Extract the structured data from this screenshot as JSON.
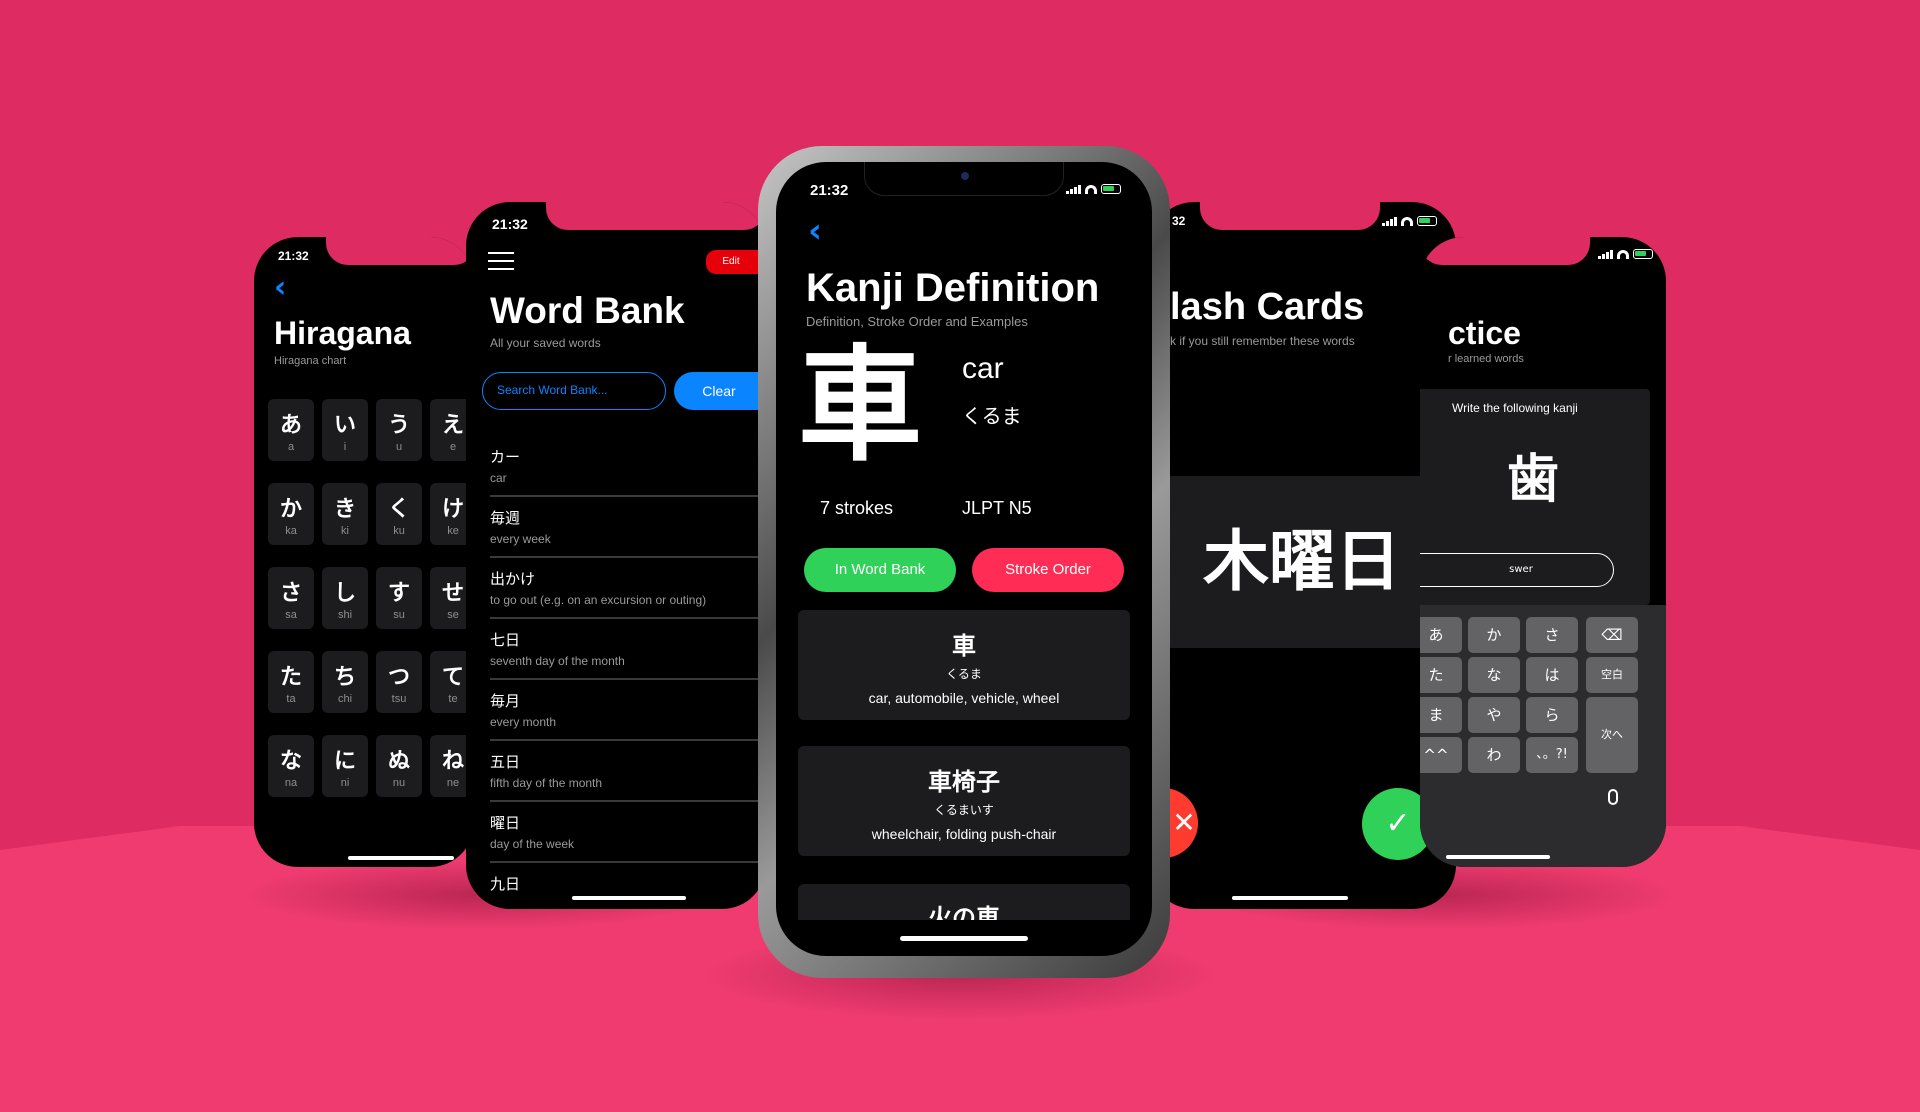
{
  "colors": {
    "background": "#de2c63",
    "accent_blue": "#0a84ff",
    "green": "#30d158",
    "red": "#ff2d55",
    "card": "#1c1c1e"
  },
  "hiragana_screen": {
    "time": "21:32",
    "title": "Hiragana",
    "subtitle": "Hiragana chart",
    "back_icon": "chevron-left-icon",
    "rows": [
      [
        {
          "k": "あ",
          "r": "a"
        },
        {
          "k": "い",
          "r": "i"
        },
        {
          "k": "う",
          "r": "u"
        },
        {
          "k": "え",
          "r": "e"
        }
      ],
      [
        {
          "k": "か",
          "r": "ka"
        },
        {
          "k": "き",
          "r": "ki"
        },
        {
          "k": "く",
          "r": "ku"
        },
        {
          "k": "け",
          "r": "ke"
        }
      ],
      [
        {
          "k": "さ",
          "r": "sa"
        },
        {
          "k": "し",
          "r": "shi"
        },
        {
          "k": "す",
          "r": "su"
        },
        {
          "k": "せ",
          "r": "se"
        }
      ],
      [
        {
          "k": "た",
          "r": "ta"
        },
        {
          "k": "ち",
          "r": "chi"
        },
        {
          "k": "つ",
          "r": "tsu"
        },
        {
          "k": "て",
          "r": "te"
        }
      ],
      [
        {
          "k": "な",
          "r": "na"
        },
        {
          "k": "に",
          "r": "ni"
        },
        {
          "k": "ぬ",
          "r": "nu"
        },
        {
          "k": "ね",
          "r": "ne"
        }
      ]
    ]
  },
  "word_bank_screen": {
    "time": "21:32",
    "menu_icon": "hamburger-menu-icon",
    "edit_label": "Edit",
    "title": "Word Bank",
    "subtitle": "All your saved words",
    "search_placeholder": "Search Word Bank...",
    "clear_label": "Clear",
    "words": [
      {
        "w": "カー",
        "m": "car"
      },
      {
        "w": "毎週",
        "m": "every week"
      },
      {
        "w": "出かけ",
        "m": "to go out (e.g. on an excursion or outing)"
      },
      {
        "w": "七日",
        "m": "seventh day of the month"
      },
      {
        "w": "毎月",
        "m": "every month"
      },
      {
        "w": "五日",
        "m": "fifth day of the month"
      },
      {
        "w": "曜日",
        "m": "day of the week"
      },
      {
        "w": "九日",
        "m": ""
      }
    ]
  },
  "kanji_screen": {
    "time": "21:32",
    "back_icon": "chevron-left-icon",
    "title": "Kanji Definition",
    "subtitle": "Definition, Stroke Order and Examples",
    "kanji": "車",
    "meaning": "car",
    "reading": "くるま",
    "strokes": "7 strokes",
    "jlpt": "JLPT N5",
    "in_word_bank_label": "In Word Bank",
    "stroke_order_label": "Stroke Order",
    "examples": [
      {
        "word": "車",
        "reading": "くるま",
        "meaning": "car, automobile, vehicle, wheel"
      },
      {
        "word": "車椅子",
        "reading": "くるまいす",
        "meaning": "wheelchair, folding push-chair"
      },
      {
        "word": "火の車",
        "reading": "",
        "meaning": ""
      }
    ]
  },
  "flash_cards_screen": {
    "time": "32",
    "title": "lash Cards",
    "subtitle": "k if you still remember these words",
    "card_text": "木曜日",
    "wrong_icon": "x-icon",
    "correct_icon": "checkmark-icon"
  },
  "practice_screen": {
    "title": "ctice",
    "subtitle": "r learned words",
    "prompt": "Write the following kanji",
    "kanji": "歯",
    "answer_placeholder": "swer",
    "keys": {
      "r1": [
        "あ",
        "か",
        "さ"
      ],
      "r2": [
        "た",
        "な",
        "は"
      ],
      "r3": [
        "ま",
        "や",
        "ら"
      ],
      "r4": [
        "^^",
        "わ",
        "、。?!"
      ],
      "space": "空白",
      "next": "次へ",
      "delete_icon": "backspace-icon",
      "mic_icon": "microphone-icon"
    }
  }
}
